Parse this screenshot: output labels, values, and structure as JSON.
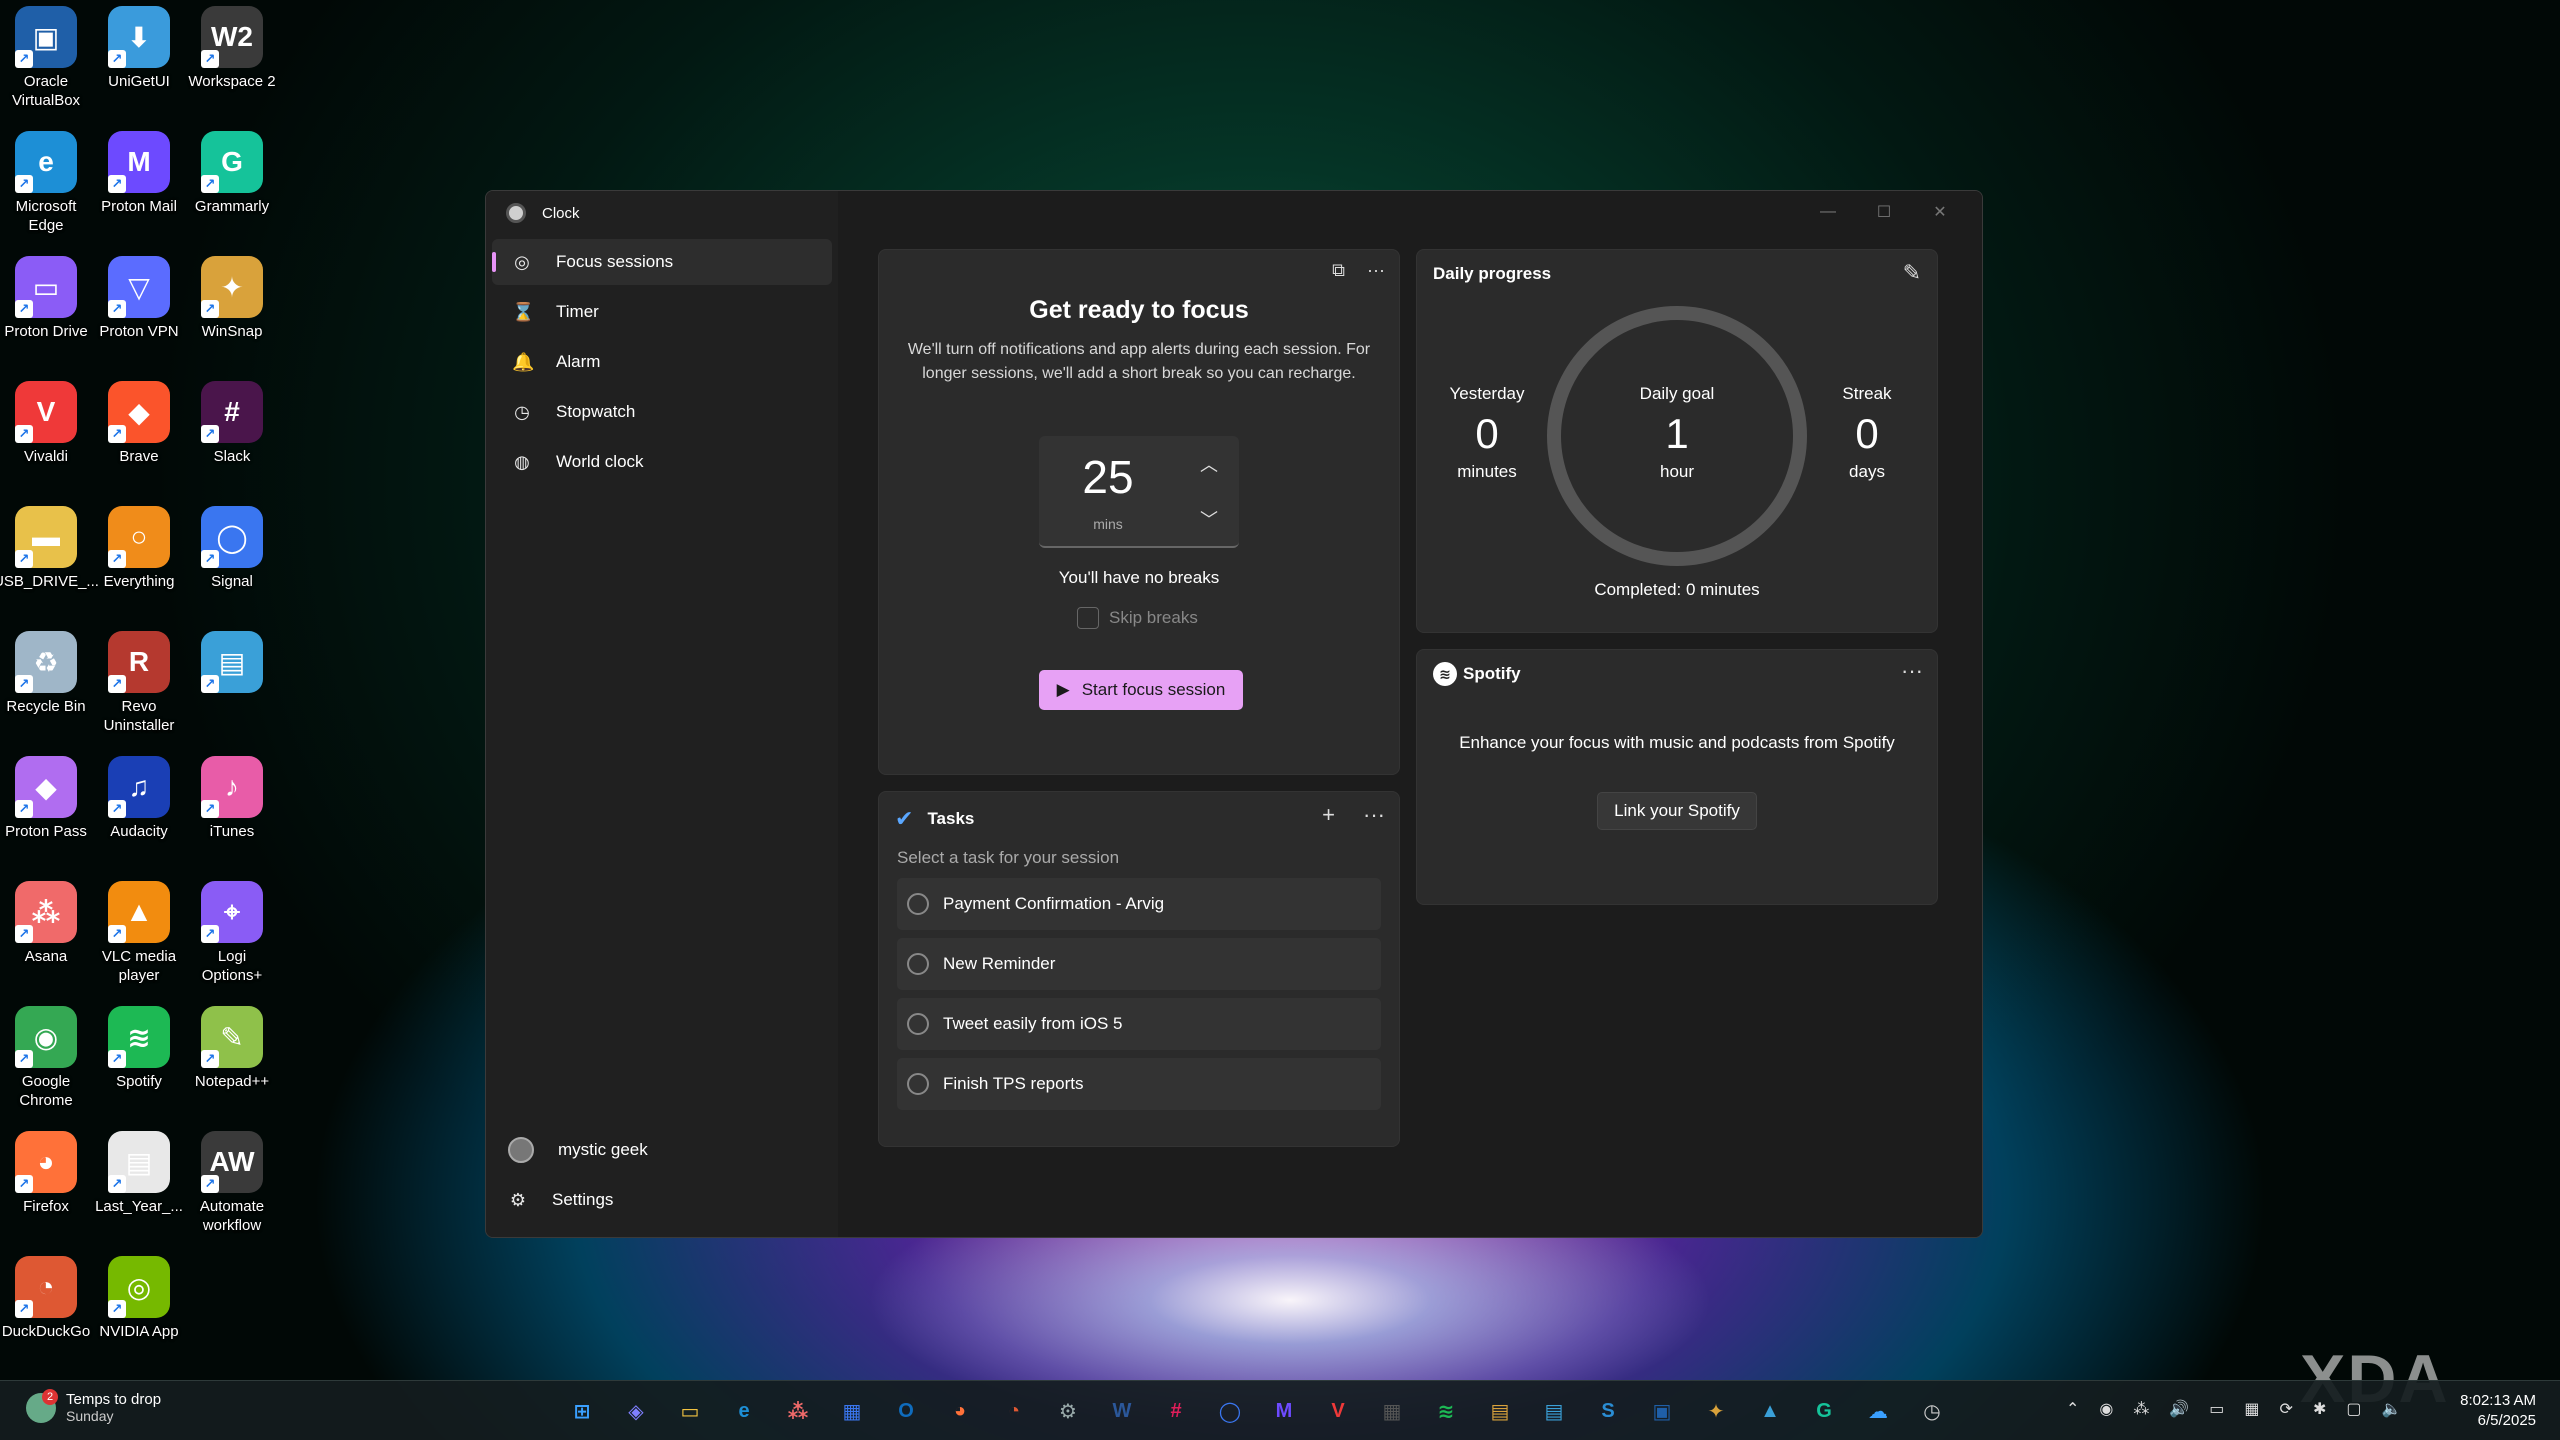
{
  "desktop": {
    "icons": [
      {
        "label": "Oracle VirtualBox",
        "glyph": "▣",
        "color": "#1f5fa8"
      },
      {
        "label": "UniGetUI",
        "glyph": "⬇",
        "color": "#3a9bdc"
      },
      {
        "label": "Workspace 2",
        "glyph": "W2",
        "color": "#3a3a3a"
      },
      {
        "label": "Microsoft Edge",
        "glyph": "e",
        "color": "#1d8fd6"
      },
      {
        "label": "Proton Mail",
        "glyph": "M",
        "color": "#6d4aff"
      },
      {
        "label": "Grammarly",
        "glyph": "G",
        "color": "#15c39a"
      },
      {
        "label": "Proton Drive",
        "glyph": "▭",
        "color": "#8b5cf6"
      },
      {
        "label": "Proton VPN",
        "glyph": "▽",
        "color": "#5b6cff"
      },
      {
        "label": "WinSnap",
        "glyph": "✦",
        "color": "#d9a23b"
      },
      {
        "label": "Vivaldi",
        "glyph": "V",
        "color": "#ef3939"
      },
      {
        "label": "Brave",
        "glyph": "◆",
        "color": "#fb542b"
      },
      {
        "label": "Slack",
        "glyph": "#",
        "color": "#4a154b"
      },
      {
        "label": "USB_DRIVE_...",
        "glyph": "▬",
        "color": "#e8c14a"
      },
      {
        "label": "Everything",
        "glyph": "○",
        "color": "#f08c1a"
      },
      {
        "label": "Signal",
        "glyph": "◯",
        "color": "#3a76f0"
      },
      {
        "label": "Recycle Bin",
        "glyph": "♻",
        "color": "#9fb6c8"
      },
      {
        "label": "Revo Uninstaller",
        "glyph": "R",
        "color": "#b5392f"
      },
      {
        "label": "",
        "glyph": "▤",
        "color": "#3aa0d8"
      },
      {
        "label": "Proton Pass",
        "glyph": "◆",
        "color": "#b06df0"
      },
      {
        "label": "Audacity",
        "glyph": "♫",
        "color": "#1a3fb5"
      },
      {
        "label": "iTunes",
        "glyph": "♪",
        "color": "#e85ca8"
      },
      {
        "label": "Asana",
        "glyph": "⁂",
        "color": "#f06a6a"
      },
      {
        "label": "VLC media player",
        "glyph": "▲",
        "color": "#f28c0f"
      },
      {
        "label": "Logi Options+",
        "glyph": "⌖",
        "color": "#8a5cf5"
      },
      {
        "label": "Google Chrome",
        "glyph": "◉",
        "color": "#34a853"
      },
      {
        "label": "Spotify",
        "glyph": "≋",
        "color": "#1db954"
      },
      {
        "label": "Notepad++",
        "glyph": "✎",
        "color": "#8fc14a"
      },
      {
        "label": "Firefox",
        "glyph": "◕",
        "color": "#ff7139"
      },
      {
        "label": "Last_Year_...",
        "glyph": "▤",
        "color": "#e8e8e8"
      },
      {
        "label": "Automate workflow",
        "glyph": "AW",
        "color": "#3a3a3a"
      },
      {
        "label": "DuckDuckGo",
        "glyph": "◔",
        "color": "#de5833"
      },
      {
        "label": "NVIDIA App",
        "glyph": "◎",
        "color": "#76b900"
      }
    ]
  },
  "window": {
    "app_title": "Clock",
    "nav": [
      {
        "label": "Focus sessions",
        "icon": "focus-icon",
        "glyph": "◎"
      },
      {
        "label": "Timer",
        "icon": "hourglass-icon",
        "glyph": "⌛"
      },
      {
        "label": "Alarm",
        "icon": "bell-icon",
        "glyph": "🔔"
      },
      {
        "label": "Stopwatch",
        "icon": "stopwatch-icon",
        "glyph": "◷"
      },
      {
        "label": "World clock",
        "icon": "globe-icon",
        "glyph": "◍"
      }
    ],
    "user_name": "mystic geek",
    "settings_label": "Settings",
    "controls": {
      "minimize": "—",
      "maximize": "☐",
      "close": "✕"
    }
  },
  "focus": {
    "title": "Get ready to focus",
    "description": "We'll turn off notifications and app alerts during each session. For longer sessions, we'll add a short break so you can recharge.",
    "minutes": "25",
    "unit": "mins",
    "breaks_text": "You'll have no breaks",
    "skip_breaks_label": "Skip breaks",
    "start_label": "Start focus session",
    "start_color": "#e7a1f5"
  },
  "tasks": {
    "title": "Tasks",
    "subtitle": "Select a task for your session",
    "items": [
      "Payment Confirmation - Arvig",
      "New Reminder",
      "Tweet easily from iOS 5",
      "Finish TPS reports"
    ]
  },
  "daily": {
    "title": "Daily progress",
    "yesterday": {
      "label": "Yesterday",
      "value": "0",
      "unit": "minutes"
    },
    "goal": {
      "label": "Daily goal",
      "value": "1",
      "unit": "hour"
    },
    "streak": {
      "label": "Streak",
      "value": "0",
      "unit": "days"
    },
    "completed": "Completed: 0 minutes",
    "progress_fraction": 0
  },
  "spotify": {
    "title": "Spotify",
    "text": "Enhance your focus with music and podcasts from Spotify",
    "link_label": "Link your Spotify"
  },
  "taskbar": {
    "weather_line1": "Temps to drop",
    "weather_line2": "Sunday",
    "weather_badge": "2",
    "apps": [
      {
        "name": "start-icon",
        "glyph": "⊞",
        "color": "#3aa0ff"
      },
      {
        "name": "copilot-icon",
        "glyph": "◈",
        "color": "#7f7fff"
      },
      {
        "name": "file-explorer-icon",
        "glyph": "▭",
        "color": "#f2c341"
      },
      {
        "name": "edge-icon",
        "glyph": "e",
        "color": "#1d8fd6"
      },
      {
        "name": "asana-icon",
        "glyph": "⁂",
        "color": "#f06a6a"
      },
      {
        "name": "store-icon",
        "glyph": "▦",
        "color": "#3a76f0"
      },
      {
        "name": "outlook-icon",
        "glyph": "O",
        "color": "#0f6cbd"
      },
      {
        "name": "firefox-icon",
        "glyph": "◕",
        "color": "#ff7139"
      },
      {
        "name": "duckduckgo-icon",
        "glyph": "◔",
        "color": "#de5833"
      },
      {
        "name": "settings-icon",
        "glyph": "⚙",
        "color": "#9aa"
      },
      {
        "name": "word-icon",
        "glyph": "W",
        "color": "#2b579a"
      },
      {
        "name": "slack-icon",
        "glyph": "#",
        "color": "#e01e5a"
      },
      {
        "name": "signal-icon",
        "glyph": "◯",
        "color": "#3a76f0"
      },
      {
        "name": "proton-mail-icon",
        "glyph": "M",
        "color": "#6d4aff"
      },
      {
        "name": "vivaldi-icon",
        "glyph": "V",
        "color": "#ef3939"
      },
      {
        "name": "calculator-icon",
        "glyph": "▦",
        "color": "#555"
      },
      {
        "name": "spotify-icon",
        "glyph": "≋",
        "color": "#1db954"
      },
      {
        "name": "app-icon",
        "glyph": "▤",
        "color": "#d9a23b"
      },
      {
        "name": "notepad-icon",
        "glyph": "▤",
        "color": "#3aa0d8"
      },
      {
        "name": "sway-icon",
        "glyph": "S",
        "color": "#2a8dd4"
      },
      {
        "name": "virtualbox-icon",
        "glyph": "▣",
        "color": "#1f5fa8"
      },
      {
        "name": "winsnap-icon",
        "glyph": "✦",
        "color": "#d9a23b"
      },
      {
        "name": "photos-icon",
        "glyph": "▲",
        "color": "#3aa0d8"
      },
      {
        "name": "grammarly-icon",
        "glyph": "G",
        "color": "#15c39a"
      },
      {
        "name": "onedrive-icon",
        "glyph": "☁",
        "color": "#3aa0ff"
      },
      {
        "name": "clock-icon",
        "glyph": "◷",
        "color": "#ccc"
      }
    ],
    "tray_icons": [
      "⌃",
      "◉",
      "⁂",
      "🔊",
      "▭",
      "▦",
      "⟳",
      "✱",
      "▢",
      "🔈"
    ],
    "time": "8:02:13 AM",
    "date": "6/5/2025"
  },
  "watermark": "XDA"
}
